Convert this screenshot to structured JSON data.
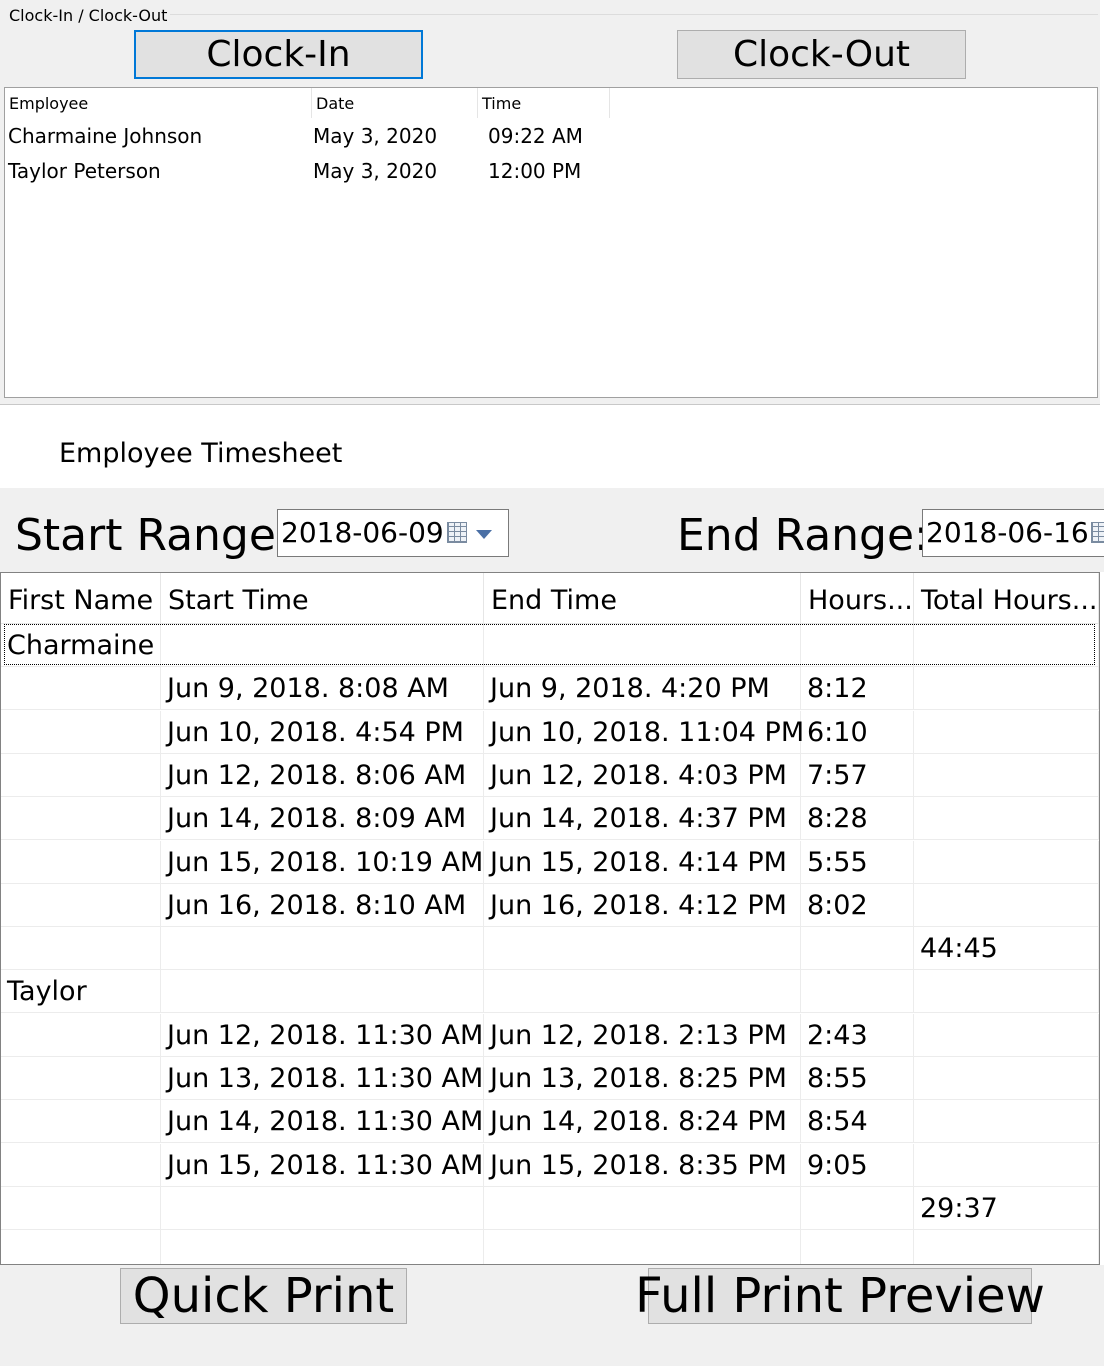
{
  "clock_group": {
    "title": "Clock-In / Clock-Out",
    "clockin_label": "Clock-In",
    "clockout_label": "Clock-Out",
    "columns": [
      "Employee",
      "Date",
      "Time"
    ],
    "rows": [
      {
        "employee": "Charmaine Johnson",
        "date": "May 3, 2020",
        "time": "09:22 AM"
      },
      {
        "employee": "Taylor Peterson",
        "date": "May 3, 2020",
        "time": "12:00 PM"
      }
    ]
  },
  "timesheet": {
    "label": "Employee Timesheet",
    "start_label": "Start Range:",
    "start_value": "2018-06-09",
    "end_label": "End Range:",
    "end_value": "2018-06-16",
    "columns": [
      "First Name",
      "Start Time",
      "End Time",
      "Hours...",
      "Total Hours..."
    ],
    "rows": [
      {
        "first": "Charmaine",
        "start": "",
        "end": "",
        "hours": "",
        "total": ""
      },
      {
        "first": "",
        "start": "Jun 9, 2018.  8:08 AM",
        "end": "Jun 9, 2018.  4:20 PM",
        "hours": "8:12",
        "total": ""
      },
      {
        "first": "",
        "start": "Jun 10, 2018.  4:54 PM",
        "end": "Jun 10, 2018.  11:04 PM",
        "hours": "6:10",
        "total": ""
      },
      {
        "first": "",
        "start": "Jun 12, 2018.  8:06 AM",
        "end": "Jun 12, 2018.  4:03 PM",
        "hours": "7:57",
        "total": ""
      },
      {
        "first": "",
        "start": "Jun 14, 2018.  8:09 AM",
        "end": "Jun 14, 2018.  4:37 PM",
        "hours": "8:28",
        "total": ""
      },
      {
        "first": "",
        "start": "Jun 15, 2018.  10:19 AM",
        "end": "Jun 15, 2018.  4:14 PM",
        "hours": "5:55",
        "total": ""
      },
      {
        "first": "",
        "start": "Jun 16, 2018.  8:10 AM",
        "end": "Jun 16, 2018.  4:12 PM",
        "hours": "8:02",
        "total": ""
      },
      {
        "first": "",
        "start": "",
        "end": "",
        "hours": "",
        "total": "44:45"
      },
      {
        "first": "Taylor",
        "start": "",
        "end": "",
        "hours": "",
        "total": ""
      },
      {
        "first": "",
        "start": "Jun 12, 2018.  11:30 AM",
        "end": "Jun 12, 2018.  2:13 PM",
        "hours": "2:43",
        "total": ""
      },
      {
        "first": "",
        "start": "Jun 13, 2018.  11:30 AM",
        "end": "Jun 13, 2018.  8:25 PM",
        "hours": "8:55",
        "total": ""
      },
      {
        "first": "",
        "start": "Jun 14, 2018.  11:30 AM",
        "end": "Jun 14, 2018.  8:24 PM",
        "hours": "8:54",
        "total": ""
      },
      {
        "first": "",
        "start": "Jun 15, 2018.  11:30 AM",
        "end": "Jun 15, 2018.  8:35 PM",
        "hours": "9:05",
        "total": ""
      },
      {
        "first": "",
        "start": "",
        "end": "",
        "hours": "",
        "total": "29:37"
      },
      {
        "first": "",
        "start": "",
        "end": "",
        "hours": "",
        "total": ""
      }
    ]
  },
  "actions": {
    "quick_print_label": "Quick Print",
    "full_preview_label": "Full Print Preview"
  }
}
